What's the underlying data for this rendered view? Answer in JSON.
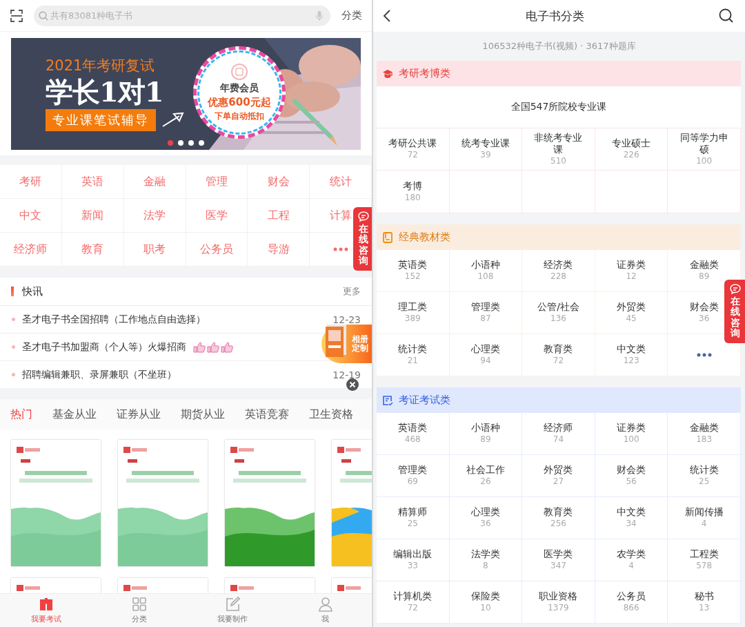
{
  "left": {
    "search": {
      "placeholder": "共有83081种电子书"
    },
    "category_link": "分类",
    "banner": {
      "headline": "2021年考研复试",
      "title": "学长1对1",
      "tag": "专业课笔试辅导",
      "badge_title": "年费会员",
      "badge_offer": "优惠600元起",
      "badge_note": "下单自动抵扣",
      "dots": [
        {
          "selected": true
        },
        {
          "selected": false
        },
        {
          "selected": false
        },
        {
          "selected": false
        }
      ]
    },
    "subjects": [
      {
        "kind": "subject",
        "label": "考研"
      },
      {
        "kind": "subject",
        "label": "英语"
      },
      {
        "kind": "subject",
        "label": "金融"
      },
      {
        "kind": "subject",
        "label": "管理"
      },
      {
        "kind": "subject",
        "label": "财会"
      },
      {
        "kind": "subject",
        "label": "统计"
      },
      {
        "kind": "subject",
        "label": "中文"
      },
      {
        "kind": "subject",
        "label": "新闻"
      },
      {
        "kind": "subject",
        "label": "法学"
      },
      {
        "kind": "subject",
        "label": "医学"
      },
      {
        "kind": "subject",
        "label": "工程"
      },
      {
        "kind": "subject",
        "label": "计算"
      },
      {
        "kind": "subject",
        "label": "经济师"
      },
      {
        "kind": "subject",
        "label": "教育"
      },
      {
        "kind": "subject",
        "label": "职考"
      },
      {
        "kind": "subject",
        "label": "公务员"
      },
      {
        "kind": "subject",
        "label": "导游"
      },
      {
        "kind": "more"
      }
    ],
    "news": {
      "title": "快讯",
      "more": "更多",
      "items": [
        {
          "kind": "plain",
          "title": "圣才电子书全国招聘（工作地点自由选择）",
          "date": "12-23"
        },
        {
          "kind": "thumbs",
          "title": "圣才电子书加盟商（个人等）火爆招商"
        },
        {
          "kind": "plain",
          "title": "招聘编辑兼职、录屏兼职（不坐班）",
          "date": "12-19"
        }
      ]
    },
    "tabs": [
      {
        "label": "热门",
        "selected": true
      },
      {
        "label": "基金从业",
        "selected": false
      },
      {
        "label": "证券从业",
        "selected": false
      },
      {
        "label": "期货从业",
        "selected": false
      },
      {
        "label": "英语竞赛",
        "selected": false
      },
      {
        "label": "卫生资格",
        "selected": false
      }
    ],
    "nav": [
      {
        "label": "我要考试",
        "selected": true
      },
      {
        "label": "分类",
        "selected": false
      },
      {
        "label": "我要制作",
        "selected": false
      },
      {
        "label": "我",
        "selected": false
      }
    ],
    "consult": {
      "label": "在线咨询"
    },
    "promo": {
      "label": "相册定制"
    }
  },
  "right": {
    "title": "电子书分类",
    "stats": "106532种电子书(视频) · 3617种题库",
    "sections": [
      {
        "kind": "exam",
        "title": "考研考博类",
        "feature": "全国547所院校专业课",
        "items": [
          {
            "kind": "category",
            "name": "考研公共课",
            "count": "72"
          },
          {
            "kind": "category",
            "name": "统考专业课",
            "count": "39"
          },
          {
            "kind": "category",
            "name": "非统考专业课",
            "count": "510"
          },
          {
            "kind": "category",
            "name": "专业硕士",
            "count": "226"
          },
          {
            "kind": "category",
            "name": "同等学力申硕",
            "count": "100"
          },
          {
            "kind": "category",
            "name": "考博",
            "count": "180"
          }
        ]
      },
      {
        "kind": "textbook",
        "title": "经典教材类",
        "items": [
          {
            "kind": "category",
            "name": "英语类",
            "count": "152"
          },
          {
            "kind": "category",
            "name": "小语种",
            "count": "108"
          },
          {
            "kind": "category",
            "name": "经济类",
            "count": "228"
          },
          {
            "kind": "category",
            "name": "证券类",
            "count": "12"
          },
          {
            "kind": "category",
            "name": "金融类",
            "count": "89"
          },
          {
            "kind": "category",
            "name": "理工类",
            "count": "389"
          },
          {
            "kind": "category",
            "name": "管理类",
            "count": "87"
          },
          {
            "kind": "category",
            "name": "公管/社会",
            "count": "136"
          },
          {
            "kind": "category",
            "name": "外贸类",
            "count": "45"
          },
          {
            "kind": "category",
            "name": "财会类",
            "count": "36"
          },
          {
            "kind": "category",
            "name": "统计类",
            "count": "21"
          },
          {
            "kind": "category",
            "name": "心理类",
            "count": "94"
          },
          {
            "kind": "category",
            "name": "教育类",
            "count": "72"
          },
          {
            "kind": "category",
            "name": "中文类",
            "count": "123"
          },
          {
            "kind": "more"
          }
        ]
      },
      {
        "kind": "cert",
        "title": "考证考试类",
        "items": [
          {
            "kind": "category",
            "name": "英语类",
            "count": "468"
          },
          {
            "kind": "category",
            "name": "小语种",
            "count": "89"
          },
          {
            "kind": "category",
            "name": "经济师",
            "count": "74"
          },
          {
            "kind": "category",
            "name": "证券类",
            "count": "100"
          },
          {
            "kind": "category",
            "name": "金融类",
            "count": "183"
          },
          {
            "kind": "category",
            "name": "管理类",
            "count": "69"
          },
          {
            "kind": "category",
            "name": "社会工作",
            "count": "26"
          },
          {
            "kind": "category",
            "name": "外贸类",
            "count": "27"
          },
          {
            "kind": "category",
            "name": "财会类",
            "count": "56"
          },
          {
            "kind": "category",
            "name": "统计类",
            "count": "25"
          },
          {
            "kind": "category",
            "name": "精算师",
            "count": "25"
          },
          {
            "kind": "category",
            "name": "心理类",
            "count": "36"
          },
          {
            "kind": "category",
            "name": "教育类",
            "count": "256"
          },
          {
            "kind": "category",
            "name": "中文类",
            "count": "34"
          },
          {
            "kind": "category",
            "name": "新闻传播",
            "count": "4"
          },
          {
            "kind": "category",
            "name": "编辑出版",
            "count": "33"
          },
          {
            "kind": "category",
            "name": "法学类",
            "count": "8"
          },
          {
            "kind": "category",
            "name": "医学类",
            "count": "347"
          },
          {
            "kind": "category",
            "name": "农学类",
            "count": "4"
          },
          {
            "kind": "category",
            "name": "工程类",
            "count": "578"
          },
          {
            "kind": "category",
            "name": "计算机类",
            "count": "72"
          },
          {
            "kind": "category",
            "name": "保险类",
            "count": "10"
          },
          {
            "kind": "category",
            "name": "职业资格",
            "count": "1379"
          },
          {
            "kind": "category",
            "name": "公务员",
            "count": "866"
          },
          {
            "kind": "category",
            "name": "秘书",
            "count": "13"
          }
        ]
      }
    ],
    "consult": {
      "label": "在线咨询"
    }
  }
}
